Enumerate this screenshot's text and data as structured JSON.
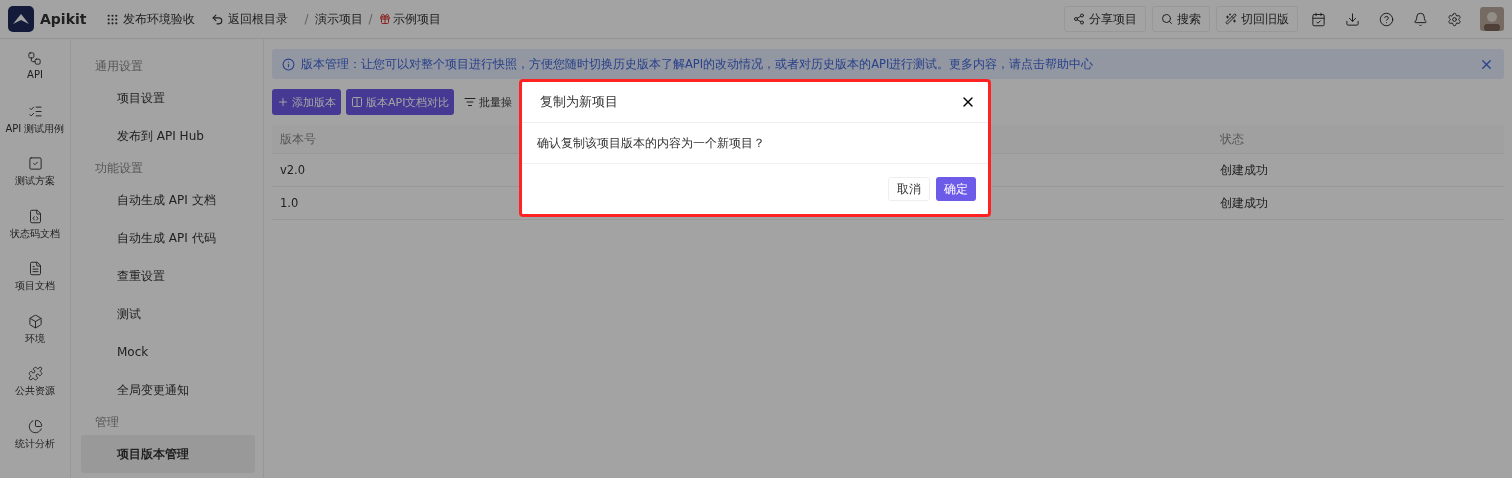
{
  "topbar": {
    "brand": "Apikit",
    "env": "发布环境验收",
    "back": "返回根目录",
    "breadcrumb": [
      {
        "separator": "/",
        "label": "演示项目"
      },
      {
        "separator": "/",
        "label": "示例项目"
      }
    ],
    "actions": [
      {
        "kind": "share",
        "label": "分享项目"
      },
      {
        "kind": "search",
        "label": "搜索"
      },
      {
        "kind": "wand",
        "label": "切回旧版"
      }
    ]
  },
  "rail": [
    {
      "label": "API"
    },
    {
      "label": "API 测试用例"
    },
    {
      "label": "测试方案"
    },
    {
      "label": "状态码文档"
    },
    {
      "label": "项目文档"
    },
    {
      "label": "环境"
    },
    {
      "label": "公共资源"
    },
    {
      "label": "统计分析"
    }
  ],
  "menu": [
    {
      "group": "通用设置",
      "items": [
        {
          "label": "项目设置",
          "selected": false
        },
        {
          "label": "发布到 API Hub",
          "selected": false
        }
      ]
    },
    {
      "group": "功能设置",
      "items": [
        {
          "label": "自动生成 API 文档",
          "selected": false
        },
        {
          "label": "自动生成 API 代码",
          "selected": false
        },
        {
          "label": "查重设置",
          "selected": false
        },
        {
          "label": "测试",
          "selected": false
        },
        {
          "label": "Mock",
          "selected": false
        },
        {
          "label": "全局变更通知",
          "selected": false
        }
      ]
    },
    {
      "group": "管理",
      "items": [
        {
          "label": "项目版本管理",
          "selected": true
        }
      ]
    }
  ],
  "alert": {
    "text": "版本管理：让您可以对整个项目进行快照，方便您随时切换历史版本了解API的改动情况，或者对历史版本的API进行测试。更多内容，请点击帮助中心"
  },
  "toolbar": [
    {
      "kind": "primary",
      "label": "添加版本"
    },
    {
      "kind": "primary",
      "label": "版本API文档对比"
    },
    {
      "kind": "plain",
      "label": "批量操"
    }
  ],
  "table": {
    "columns": [
      "版本号",
      "状态"
    ],
    "rows": [
      [
        "v2.0",
        "创建成功"
      ],
      [
        "1.0",
        "创建成功"
      ]
    ]
  },
  "dialog": {
    "title": "复制为新项目",
    "message": "确认复制该项目版本的内容为一个新项目？",
    "buttons": [
      {
        "kind": "default",
        "label": "取消"
      },
      {
        "kind": "primary",
        "label": "确定"
      }
    ]
  }
}
